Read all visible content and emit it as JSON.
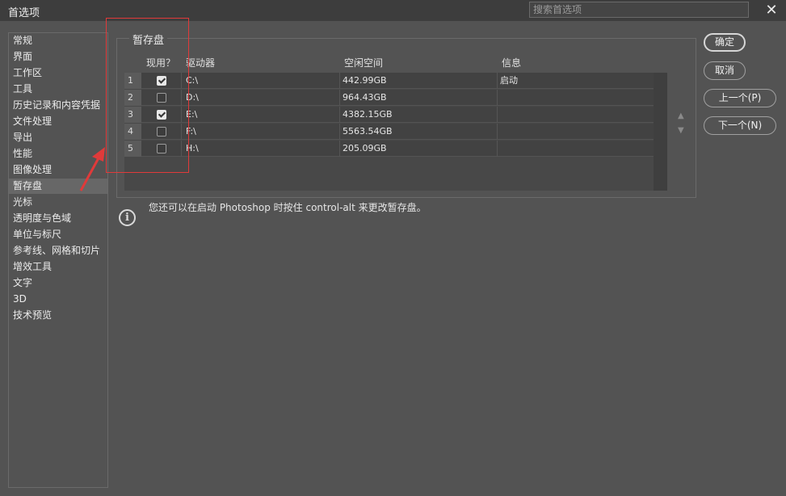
{
  "window": {
    "title": "首选项",
    "search_placeholder": "搜索首选项",
    "close_glyph": "✕"
  },
  "sidebar": {
    "items": [
      {
        "label": "常规"
      },
      {
        "label": "界面"
      },
      {
        "label": "工作区"
      },
      {
        "label": "工具"
      },
      {
        "label": "历史记录和内容凭据"
      },
      {
        "label": "文件处理"
      },
      {
        "label": "导出"
      },
      {
        "label": "性能"
      },
      {
        "label": "图像处理"
      },
      {
        "label": "暂存盘"
      },
      {
        "label": "光标"
      },
      {
        "label": "透明度与色域"
      },
      {
        "label": "单位与标尺"
      },
      {
        "label": "参考线、网格和切片"
      },
      {
        "label": "增效工具"
      },
      {
        "label": "文字"
      },
      {
        "label": "3D"
      },
      {
        "label": "技术预览"
      }
    ],
    "active": "暂存盘"
  },
  "scratch": {
    "title": "暂存盘",
    "headers": {
      "active": "现用？",
      "drive": "驱动器",
      "free": "空闲空间",
      "info": "信息"
    },
    "rows": [
      {
        "num": "1",
        "checked": true,
        "drive": "C:\\",
        "free": "442.99GB",
        "info": "启动"
      },
      {
        "num": "2",
        "checked": false,
        "drive": "D:\\",
        "free": "964.43GB",
        "info": ""
      },
      {
        "num": "3",
        "checked": true,
        "drive": "E:\\",
        "free": "4382.15GB",
        "info": ""
      },
      {
        "num": "4",
        "checked": false,
        "drive": "F:\\",
        "free": "5563.54GB",
        "info": ""
      },
      {
        "num": "5",
        "checked": false,
        "drive": "H:\\",
        "free": "205.09GB",
        "info": ""
      }
    ],
    "up_arrow": "▲",
    "down_arrow": "▼"
  },
  "info": {
    "icon": "i",
    "text": "您还可以在启动 Photoshop 时按住 control-alt 来更改暂存盘。"
  },
  "buttons": {
    "ok": "确定",
    "cancel": "取消",
    "prev": "上一个(P)",
    "next": "下一个(N)"
  },
  "colors": {
    "annotation": "#e03a3a",
    "background": "#535353",
    "titlebar": "#3d3d3d"
  }
}
